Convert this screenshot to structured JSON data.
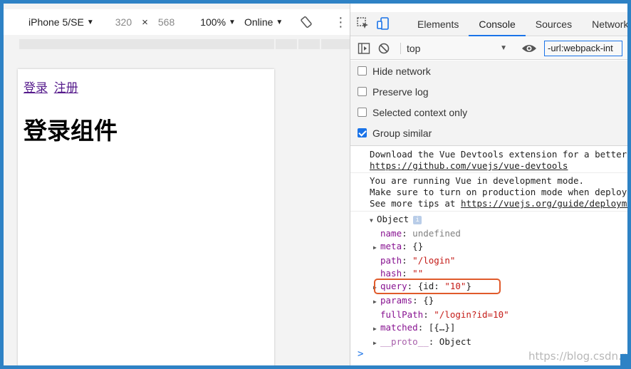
{
  "device_toolbar": {
    "device": "iPhone 5/SE",
    "width": "320",
    "times": "×",
    "height": "568",
    "zoom": "100%",
    "network": "Online",
    "more": "⋮"
  },
  "page": {
    "link_login": "登录",
    "link_register": "注册",
    "heading": "登录组件"
  },
  "devtools": {
    "tabs": [
      "Elements",
      "Console",
      "Sources",
      "Network"
    ],
    "active_tab": "Console",
    "context": "top",
    "filter_value": "-url:webpack-int",
    "settings": [
      {
        "label": "Hide network",
        "checked": false
      },
      {
        "label": "Preserve log",
        "checked": false
      },
      {
        "label": "Selected context only",
        "checked": false
      },
      {
        "label": "Group similar",
        "checked": true
      }
    ]
  },
  "console": {
    "msg1_line1": "Download the Vue Devtools extension for a better",
    "msg1_link": "https://github.com/vuejs/vue-devtools",
    "msg2_line1": "You are running Vue in development mode.",
    "msg2_line2": "Make sure to turn on production mode when deploying",
    "msg2_line3_prefix": "See more tips at ",
    "msg2_line3_link": "https://vuejs.org/guide/deployment",
    "object_label": "Object",
    "info_badge": "i",
    "props": {
      "name_key": "name",
      "name_val": "undefined",
      "meta_key": "meta",
      "meta_val": "{}",
      "path_key": "path",
      "path_val": "\"/login\"",
      "hash_key": "hash",
      "hash_val": "\"\"",
      "query_key": "query",
      "query_open": "{",
      "query_id_key": "id",
      "query_id_val": "\"10\"",
      "query_close": "}",
      "params_key": "params",
      "params_val": "{}",
      "fullPath_key": "fullPath",
      "fullPath_val": "\"/login?id=10\"",
      "matched_key": "matched",
      "matched_val": "[{…}]",
      "proto_key": "__proto__",
      "proto_val": "Object"
    },
    "prompt": ">",
    "watermark": "https://blog.csdn.net @稀土掘金技术社区"
  },
  "colors": {
    "frame": "#2e82c5",
    "accent": "#1a73e8",
    "highlight": "#e05a2b",
    "key": "#881391",
    "string": "#c41a16",
    "link": "#551a8b"
  }
}
